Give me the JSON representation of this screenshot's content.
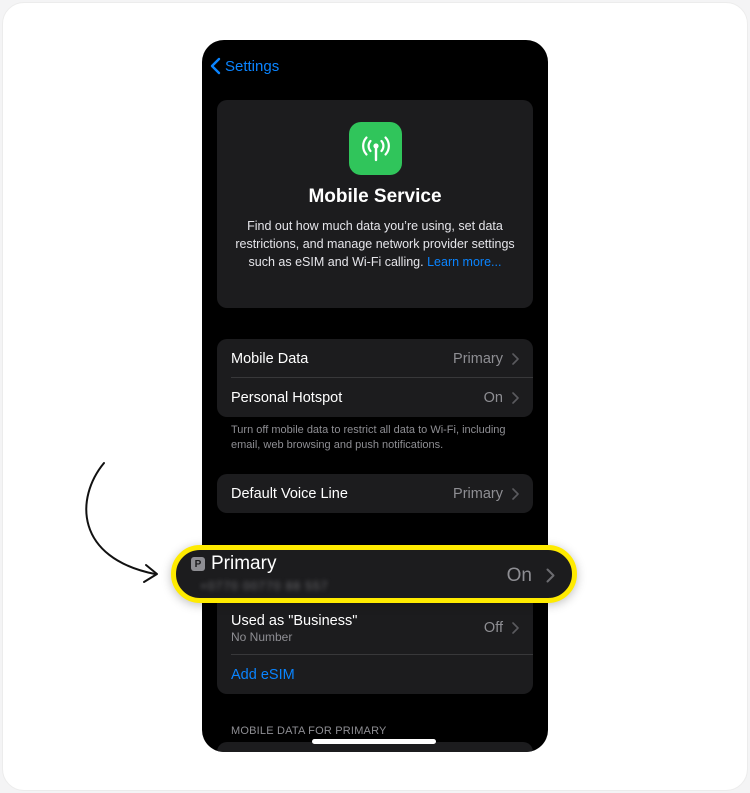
{
  "nav": {
    "back_label": "Settings"
  },
  "hero": {
    "title": "Mobile Service",
    "description": "Find out how much data you’re using, set data restrictions, and manage network provider settings such as eSIM and Wi-Fi calling.",
    "link_label": "Learn more..."
  },
  "data_group": {
    "items": [
      {
        "label": "Mobile Data",
        "value": "Primary"
      },
      {
        "label": "Personal Hotspot",
        "value": "On"
      }
    ],
    "footnote": "Turn off mobile data to restrict all data to Wi-Fi, including email, web browsing and push notifications."
  },
  "voice": {
    "label": "Default Voice Line",
    "value": "Primary"
  },
  "lines": {
    "primary": {
      "badge": "P",
      "label": "Primary",
      "number": "+0770 00770 88 557",
      "value": "On"
    },
    "business": {
      "label": "Used as \"Business\"",
      "sublabel": "No Number",
      "value": "Off"
    },
    "add_esim_label": "Add eSIM"
  },
  "section_header": "MOBILE DATA FOR PRIMARY",
  "colors": {
    "accent": "#0a84ff",
    "icon_green": "#30c55b",
    "highlight": "#ffeb00"
  },
  "icons": {
    "back": "chevron-left",
    "app": "antenna-signal",
    "row": "chevron-right"
  }
}
